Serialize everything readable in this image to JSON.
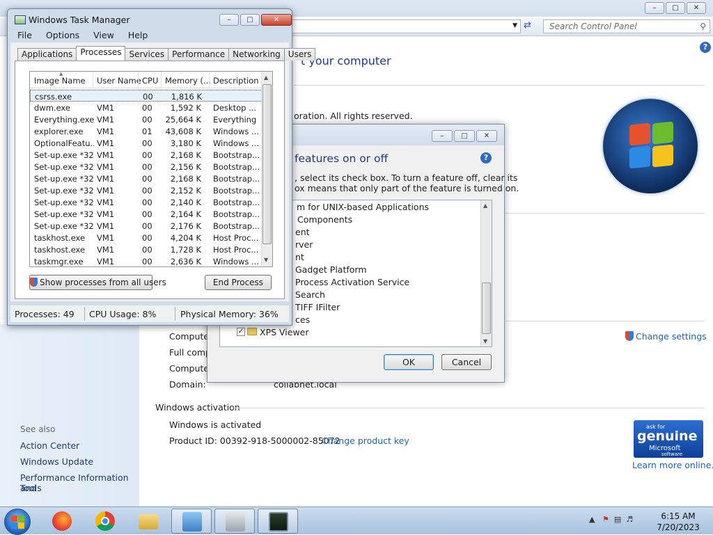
{
  "control_panel": {
    "search_placeholder": "Search Control Panel",
    "heading_partial": "t your computer",
    "copyright_partial": "oration.  All rights reserved.",
    "change_settings": "Change settings",
    "computer_name_label": "Computer",
    "full_name_label": "Full comp",
    "description_label": "Computer",
    "domain_label": "Domain:",
    "domain_value": "collabnet.local",
    "activation_section": "Windows activation",
    "activation_status": "Windows is activated",
    "product_id": "Product ID:  00392-918-5000002-85072",
    "change_product_key": "Change product key",
    "learn_more": "Learn more online...",
    "genuine": {
      "line1": "ask for",
      "line2": "genuine",
      "line3": "Microsoft",
      "line4": "software"
    },
    "see_also": "See also",
    "sidebar": [
      "Action Center",
      "Windows Update",
      "Performance Information and",
      "Tools"
    ]
  },
  "features_dialog": {
    "heading": "features on or off",
    "desc1": ", select its check box. To turn a feature off, clear its",
    "desc2": "ox means that only part of the feature is turned on.",
    "items": [
      "m for UNIX-based Applications",
      "Components",
      "ent",
      "rver",
      "nt",
      "Gadget Platform",
      "Process Activation Service",
      "Search",
      "TIFF IFilter",
      "ces",
      "XPS Viewer"
    ],
    "ok": "OK",
    "cancel": "Cancel"
  },
  "task_manager": {
    "title": "Windows Task Manager",
    "menu": [
      "File",
      "Options",
      "View",
      "Help"
    ],
    "tabs": [
      "Applications",
      "Processes",
      "Services",
      "Performance",
      "Networking",
      "Users"
    ],
    "active_tab": "Processes",
    "columns": [
      "Image Name",
      "User Name",
      "CPU",
      "Memory (...",
      "Description"
    ],
    "rows": [
      [
        "csrss.exe",
        "",
        "00",
        "1,816 K",
        ""
      ],
      [
        "dwm.exe",
        "VM1",
        "00",
        "1,592 K",
        "Desktop ..."
      ],
      [
        "Everything.exe",
        "VM1",
        "00",
        "25,664 K",
        "Everything"
      ],
      [
        "explorer.exe",
        "VM1",
        "01",
        "43,608 K",
        "Windows ..."
      ],
      [
        "OptionalFeatu...",
        "VM1",
        "00",
        "3,180 K",
        "Windows ..."
      ],
      [
        "Set-up.exe *32",
        "VM1",
        "00",
        "2,168 K",
        "Bootstrap..."
      ],
      [
        "Set-up.exe *32",
        "VM1",
        "00",
        "2,156 K",
        "Bootstrap..."
      ],
      [
        "Set-up.exe *32",
        "VM1",
        "00",
        "2,168 K",
        "Bootstrap..."
      ],
      [
        "Set-up.exe *32",
        "VM1",
        "00",
        "2,152 K",
        "Bootstrap..."
      ],
      [
        "Set-up.exe *32",
        "VM1",
        "00",
        "2,140 K",
        "Bootstrap..."
      ],
      [
        "Set-up.exe *32",
        "VM1",
        "00",
        "2,164 K",
        "Bootstrap..."
      ],
      [
        "Set-up.exe *32",
        "VM1",
        "00",
        "2,176 K",
        "Bootstrap..."
      ],
      [
        "taskhost.exe",
        "VM1",
        "00",
        "4,204 K",
        "Host Proc..."
      ],
      [
        "taskhost.exe",
        "VM1",
        "00",
        "1,728 K",
        "Host Proc..."
      ],
      [
        "taskmgr.exe",
        "VM1",
        "00",
        "2,636 K",
        "Windows ..."
      ]
    ],
    "show_all_button": "Show processes from all users",
    "end_process_button": "End Process",
    "status": {
      "processes": "Processes: 49",
      "cpu": "CPU Usage: 8%",
      "memory": "Physical Memory: 36%"
    }
  },
  "taskbar": {
    "time": "6:15 AM",
    "date": "7/20/2023"
  },
  "colors": {
    "accent": "#1e3b8f",
    "link": "#1f62c8"
  }
}
